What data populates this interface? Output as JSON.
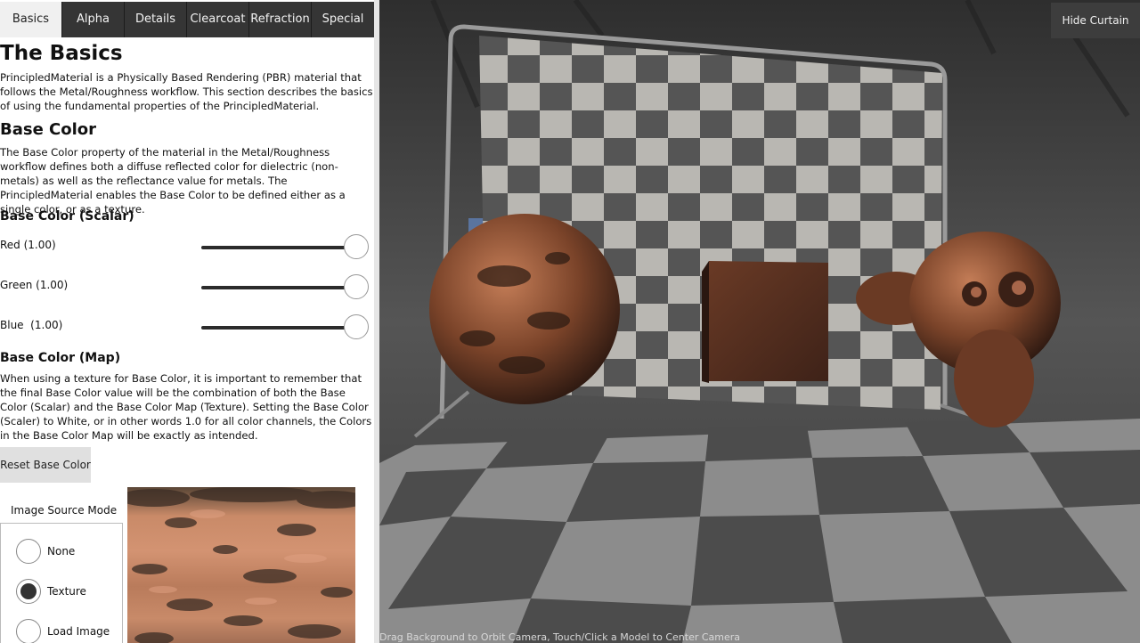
{
  "tabs": [
    {
      "label": "Basics",
      "active": true
    },
    {
      "label": "Alpha"
    },
    {
      "label": "Details"
    },
    {
      "label": "Clearcoat"
    },
    {
      "label": "Refraction"
    },
    {
      "label": "Special"
    }
  ],
  "content": {
    "title": "The Basics",
    "intro": "PrincipledMaterial is a Physically Based Rendering (PBR) material that follows the Metal/Roughness workflow. This section describes the basics of using the fundamental properties of the PrincipledMaterial.",
    "base_color_heading": "Base Color",
    "base_color_desc": "The Base Color property of the material in the Metal/Roughness workflow defines both a diffuse reflected color for dielectric (non-metals) as well as the reflectance value for metals. The PrincipledMaterial enables the Base Color to be defined either as a single color, or as a texture.",
    "scalar_heading": "Base Color (Scalar)",
    "sliders": [
      {
        "label": "Red (1.00)",
        "value": 1.0
      },
      {
        "label": "Green (1.00)",
        "value": 1.0
      },
      {
        "label": "Blue  (1.00)",
        "value": 1.0
      }
    ],
    "map_heading": "Base Color (Map)",
    "map_desc": "When using a texture for Base Color, it is important to remember that the final Base Color value will be the combination of both the Base Color (Scalar) and the Base Color Map (Texture). Setting the Base Color (Scaler) to White, or in other words 1.0 for all color channels, the Colors in the Base Color Map will be exactly as intended.",
    "reset_button": "Reset Base Color",
    "image_source_label": "Image Source Mode",
    "image_source_options": [
      {
        "label": "None",
        "checked": false
      },
      {
        "label": "Texture",
        "checked": true
      },
      {
        "label": "Load Image",
        "checked": false
      }
    ]
  },
  "viewport": {
    "hide_curtain_button": "Hide Curtain",
    "hint": "Drag Background to Orbit Camera, Touch/Click a Model to Center Camera"
  }
}
